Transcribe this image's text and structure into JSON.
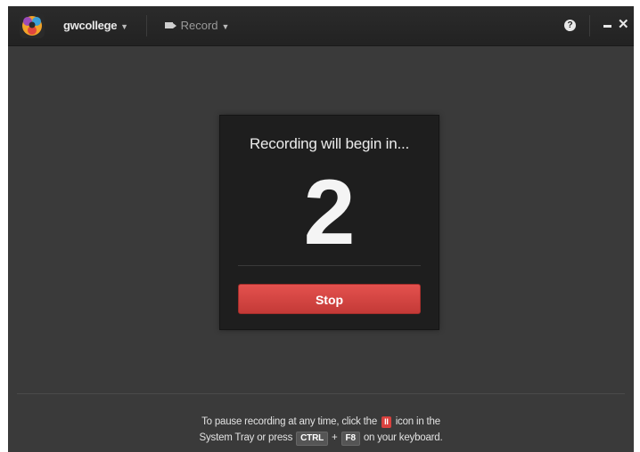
{
  "titlebar": {
    "account_label": "gwcollege",
    "record_label": "Record",
    "help_glyph": "?",
    "close_glyph": "✕"
  },
  "countdown": {
    "title": "Recording will begin in...",
    "value": "2",
    "stop_label": "Stop"
  },
  "footer": {
    "line1_before": "To pause recording at any time, click the",
    "pause_icon_text": "II",
    "line1_after": "icon in the",
    "line2_before": "System Tray or press",
    "key1": "CTRL",
    "plus": "+",
    "key2": "F8",
    "line2_after": "on your keyboard."
  },
  "colors": {
    "titlebar": "#252525",
    "background": "#3a3a3a",
    "card": "#1e1e1e",
    "stop_button": "#d4443f"
  },
  "icons": {
    "logo": "app-logo-icon",
    "record": "video-camera-icon",
    "help": "help-icon",
    "minimize": "minimize-icon",
    "close": "close-icon",
    "dropdown": "caret-down-icon"
  }
}
